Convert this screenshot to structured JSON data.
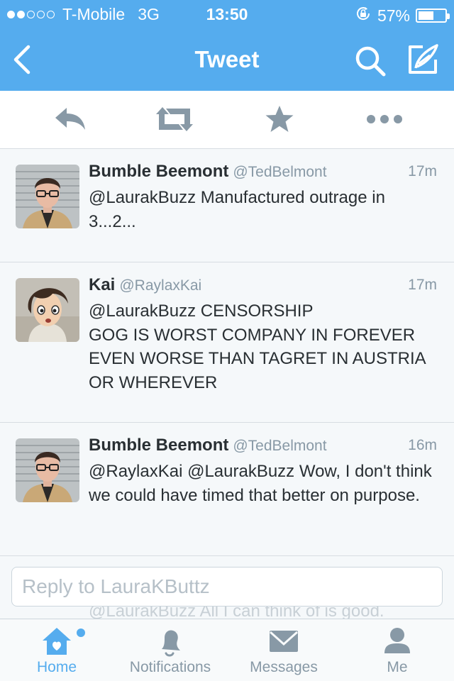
{
  "status_bar": {
    "carrier": "T-Mobile",
    "network": "3G",
    "time": "13:50",
    "battery": "57%",
    "battery_level": 0.57,
    "signal_bars": 2,
    "signal_total": 5
  },
  "nav": {
    "title": "Tweet",
    "back_icon": "chevron-left-icon",
    "search_icon": "search-icon",
    "compose_icon": "compose-icon"
  },
  "actions": {
    "reply_icon": "reply-icon",
    "retweet_icon": "retweet-icon",
    "favorite_icon": "star-icon",
    "more_icon": "more-icon"
  },
  "tweets": [
    {
      "name": "Bumble Beemont",
      "handle": "@TedBelmont",
      "time": "17m",
      "text": "@LaurakBuzz Manufactured outrage in 3...2..."
    },
    {
      "name": "Kai",
      "handle": "@RaylaxKai",
      "time": "17m",
      "text": "@LaurakBuzz CENSORSHIP\nGOG IS WORST COMPANY IN FOREVER EVEN WORSE THAN TAGRET IN AUSTRIA OR WHEREVER"
    },
    {
      "name": "Bumble Beemont",
      "handle": "@TedBelmont",
      "time": "16m",
      "text": "@RaylaxKai @LaurakBuzz Wow, I don't think we could have timed that better on purpose."
    }
  ],
  "reply": {
    "placeholder": "Reply to LauraKButtz",
    "ghost_text": "@LaurakBuzz All I can think of is good."
  },
  "tabs": [
    {
      "label": "Home",
      "icon": "home-icon",
      "active": true
    },
    {
      "label": "Notifications",
      "icon": "bell-icon",
      "active": false
    },
    {
      "label": "Messages",
      "icon": "envelope-icon",
      "active": false
    },
    {
      "label": "Me",
      "icon": "person-icon",
      "active": false
    }
  ],
  "colors": {
    "brand": "#55acee",
    "icon_gray": "#8899a6",
    "text": "#292f33"
  }
}
